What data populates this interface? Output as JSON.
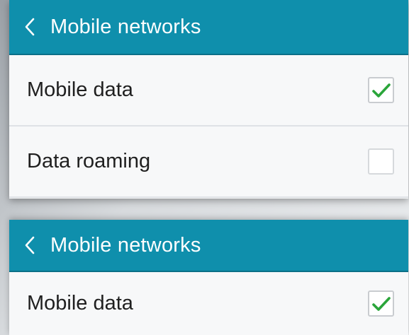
{
  "screens": [
    {
      "header": {
        "back_icon": "chevron-left-icon",
        "title": "Mobile networks"
      },
      "items": [
        {
          "label": "Mobile data",
          "checked": true
        },
        {
          "label": "Data roaming",
          "checked": false
        }
      ]
    },
    {
      "header": {
        "back_icon": "chevron-left-icon",
        "title": "Mobile networks"
      },
      "items": [
        {
          "label": "Mobile data",
          "checked": true
        }
      ]
    }
  ],
  "colors": {
    "header_bg": "#0f8fac",
    "check_green": "#2aa53a",
    "row_bg": "#f7f8f9"
  }
}
